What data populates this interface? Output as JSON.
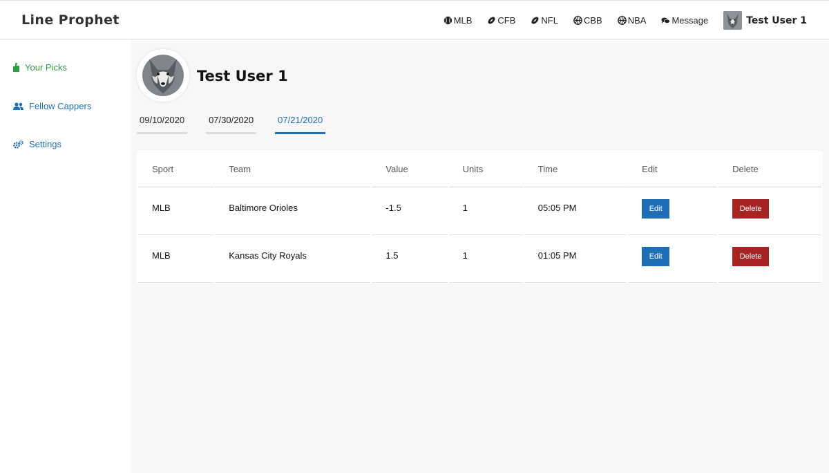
{
  "brand": "Line Prophet",
  "nav": {
    "items": [
      {
        "label": "MLB",
        "icon": "baseball-icon"
      },
      {
        "label": "CFB",
        "icon": "football-icon"
      },
      {
        "label": "NFL",
        "icon": "football-icon"
      },
      {
        "label": "CBB",
        "icon": "basketball-icon"
      },
      {
        "label": "NBA",
        "icon": "basketball-icon"
      },
      {
        "label": "Message",
        "icon": "comments-icon"
      }
    ],
    "user_name": "Test User 1"
  },
  "sidebar": {
    "items": [
      {
        "label": "Your Picks",
        "icon": "thumbs-up-icon",
        "color": "#2f9e44"
      },
      {
        "label": "Fellow Cappers",
        "icon": "users-icon",
        "color": "#1f6fb8"
      },
      {
        "label": "Settings",
        "icon": "cogs-icon",
        "color": "#1f6fb8"
      }
    ]
  },
  "profile": {
    "name": "Test User 1"
  },
  "tabs": [
    {
      "label": "09/10/2020",
      "active": false
    },
    {
      "label": "07/30/2020",
      "active": false
    },
    {
      "label": "07/21/2020",
      "active": true
    }
  ],
  "table": {
    "headers": [
      "Sport",
      "Team",
      "Value",
      "Units",
      "Time",
      "Edit",
      "Delete"
    ],
    "rows": [
      {
        "sport": "MLB",
        "team": "Baltimore Orioles",
        "value": "-1.5",
        "units": "1",
        "time": "05:05 PM",
        "edit": "Edit",
        "delete": "Delete"
      },
      {
        "sport": "MLB",
        "team": "Kansas City Royals",
        "value": "1.5",
        "units": "1",
        "time": "01:05 PM",
        "edit": "Edit",
        "delete": "Delete"
      }
    ]
  },
  "colors": {
    "accent_blue": "#1f6fb8",
    "picks_green": "#2f9e44",
    "delete_red": "#a82424"
  }
}
